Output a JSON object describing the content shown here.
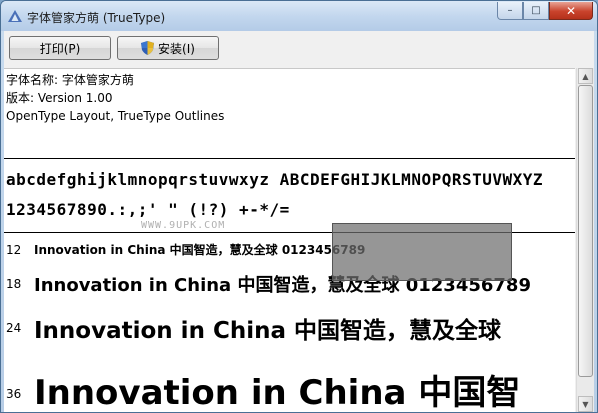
{
  "window": {
    "title": "字体管家方萌 (TrueType)"
  },
  "titlebar_buttons": {
    "minimize": "–",
    "maximize": "□",
    "close": "✕"
  },
  "toolbar": {
    "print_label": "打印(P)",
    "install_label": "安装(I)"
  },
  "info": {
    "font_name": "字体名称: 字体管家方萌",
    "version": "版本: Version 1.00",
    "outline": "OpenType Layout, TrueType Outlines"
  },
  "charset": {
    "letters": "abcdefghijklmnopqrstuvwxyz ABCDEFGHIJKLMNOPQRSTUVWXYZ",
    "digits": "1234567890.:,;' \" (!?) +-*/="
  },
  "watermark": "WWW.9UPK.COM",
  "samples": [
    {
      "size": "12",
      "text": "Innovation in China 中国智造，慧及全球 0123456789"
    },
    {
      "size": "18",
      "text": "Innovation in China 中国智造，慧及全球 0123456789"
    },
    {
      "size": "24",
      "text": "Innovation in China 中国智造，慧及全球"
    },
    {
      "size": "36",
      "text": "Innovation in China 中国智"
    }
  ],
  "scrollbar": {
    "up": "▲",
    "down": "▼"
  }
}
